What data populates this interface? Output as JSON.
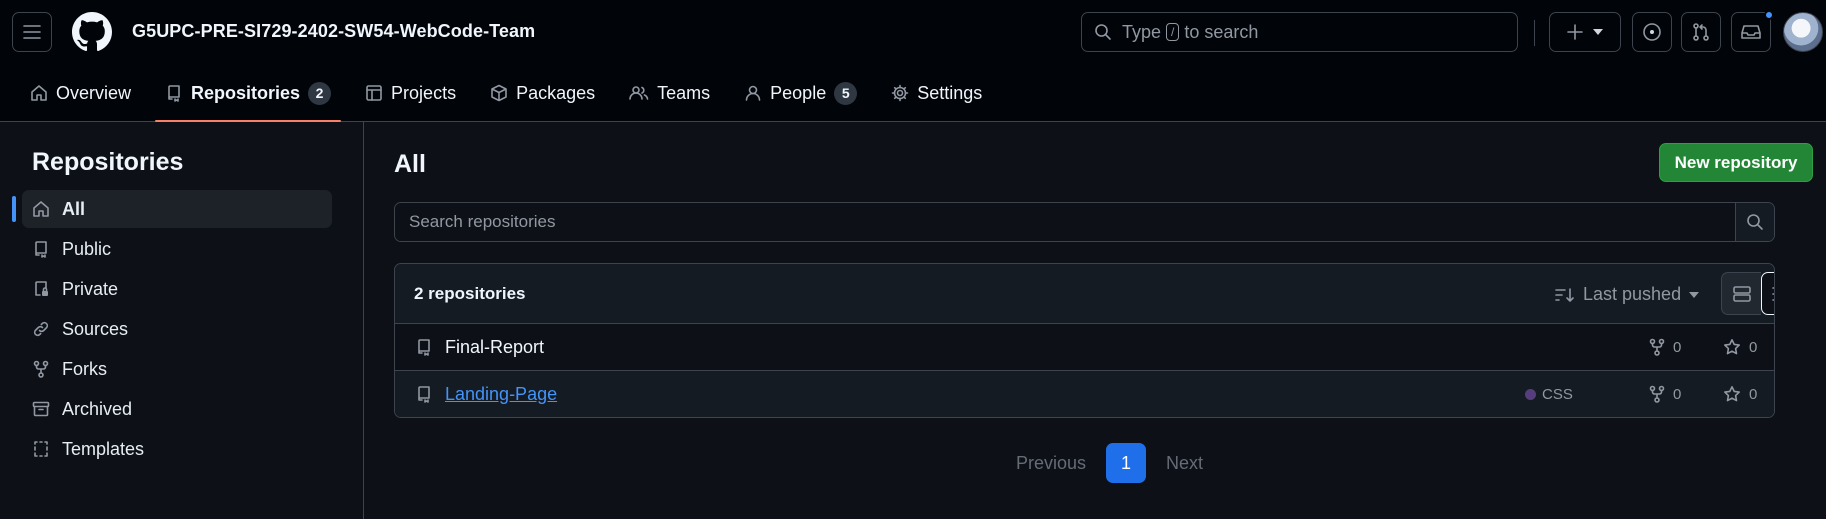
{
  "header": {
    "org_name": "G5UPC-PRE-SI729-2402-SW54-WebCode-Team",
    "search_prefix": "Type",
    "search_key": "/",
    "search_suffix": "to search",
    "icons": [
      "hamburger-menu-icon",
      "github-logo-icon",
      "search-icon",
      "plus-icon",
      "chevron-down-icon",
      "issue-opened-icon",
      "git-pull-request-icon",
      "inbox-icon"
    ],
    "has_unread_notifications": true
  },
  "tabs": [
    {
      "label": "Overview",
      "icon": "home-icon"
    },
    {
      "label": "Repositories",
      "icon": "repo-icon",
      "count": "2",
      "active": true
    },
    {
      "label": "Projects",
      "icon": "table-icon"
    },
    {
      "label": "Packages",
      "icon": "package-icon"
    },
    {
      "label": "Teams",
      "icon": "people-icon"
    },
    {
      "label": "People",
      "icon": "person-icon",
      "count": "5"
    },
    {
      "label": "Settings",
      "icon": "gear-icon"
    }
  ],
  "sidebar": {
    "title": "Repositories",
    "items": [
      {
        "label": "All",
        "icon": "home-icon",
        "active": true
      },
      {
        "label": "Public",
        "icon": "repo-icon"
      },
      {
        "label": "Private",
        "icon": "lock-repo-icon"
      },
      {
        "label": "Sources",
        "icon": "link-icon"
      },
      {
        "label": "Forks",
        "icon": "fork-icon"
      },
      {
        "label": "Archived",
        "icon": "archive-icon"
      },
      {
        "label": "Templates",
        "icon": "template-icon"
      }
    ]
  },
  "main": {
    "title": "All",
    "new_repo_label": "New repository",
    "search_placeholder": "Search repositories",
    "repo_count_label": "2 repositories",
    "sort_label": "Last pushed",
    "repos": [
      {
        "name": "Final-Report",
        "language": "",
        "forks": "0",
        "stars": "0"
      },
      {
        "name": "Landing-Page",
        "language": "CSS",
        "language_color": "#563d7c",
        "forks": "0",
        "stars": "0"
      }
    ]
  },
  "pagination": {
    "previous": "Previous",
    "current": "1",
    "next": "Next"
  },
  "colors": {
    "accent_blue": "#4493f8",
    "primary_green": "#238636",
    "active_tab_underline": "#f78166",
    "background": "#0d1117"
  }
}
